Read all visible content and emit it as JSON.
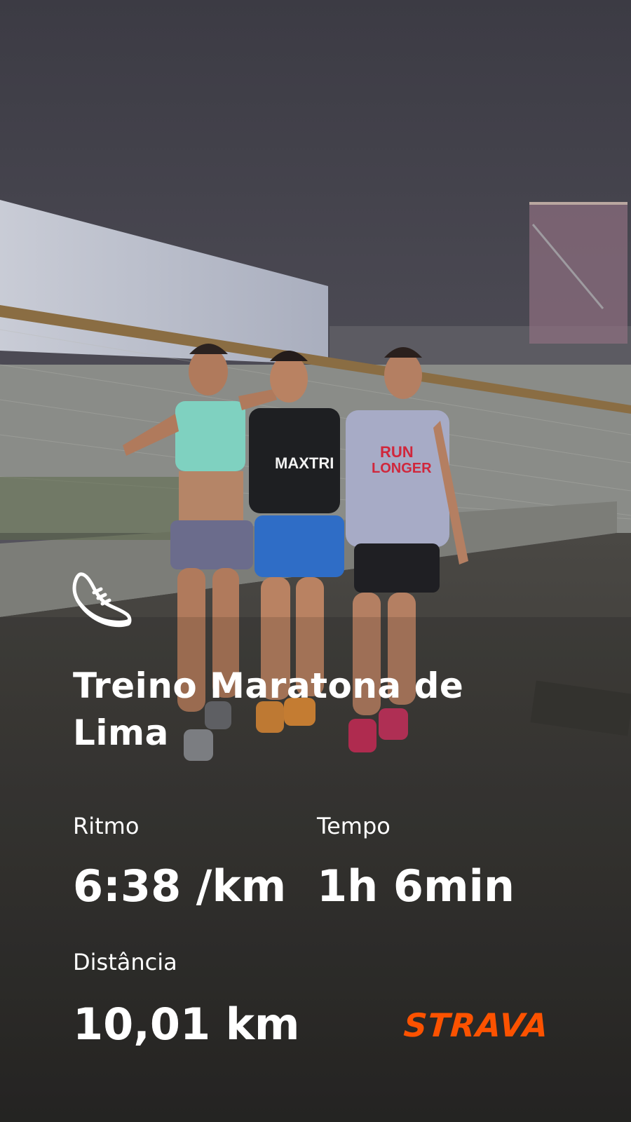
{
  "activity": {
    "icon": "running-shoe-icon",
    "title": "Treino Maratona de Lima"
  },
  "stats": {
    "pace": {
      "label": "Ritmo",
      "value": "6:38 /km"
    },
    "time": {
      "label": "Tempo",
      "value": "1h 6min"
    },
    "distance": {
      "label": "Distância",
      "value": "10,01 km"
    }
  },
  "branding": {
    "logo_text": "STRAVA",
    "logo_color": "#fc5200"
  },
  "photo": {
    "shirt_texts": [
      "MAXTRI",
      "RUN LONGER"
    ]
  }
}
